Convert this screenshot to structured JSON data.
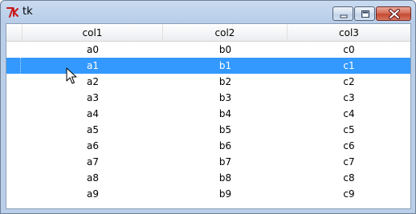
{
  "window": {
    "title": "tk"
  },
  "table": {
    "columns": [
      "col1",
      "col2",
      "col3"
    ],
    "rows": [
      [
        "a0",
        "b0",
        "c0"
      ],
      [
        "a1",
        "b1",
        "c1"
      ],
      [
        "a2",
        "b2",
        "c2"
      ],
      [
        "a3",
        "b3",
        "c3"
      ],
      [
        "a4",
        "b4",
        "c4"
      ],
      [
        "a5",
        "b5",
        "c5"
      ],
      [
        "a6",
        "b6",
        "c6"
      ],
      [
        "a7",
        "b7",
        "c7"
      ],
      [
        "a8",
        "b8",
        "c8"
      ],
      [
        "a9",
        "b9",
        "c9"
      ]
    ],
    "selected_row": 1,
    "selection_color": "#3399ff"
  },
  "icons": {
    "app": "tk-feather-icon",
    "minimize": "minimize-icon",
    "maximize": "maximize-icon",
    "close": "close-icon",
    "pointer": "mouse-pointer-icon"
  }
}
